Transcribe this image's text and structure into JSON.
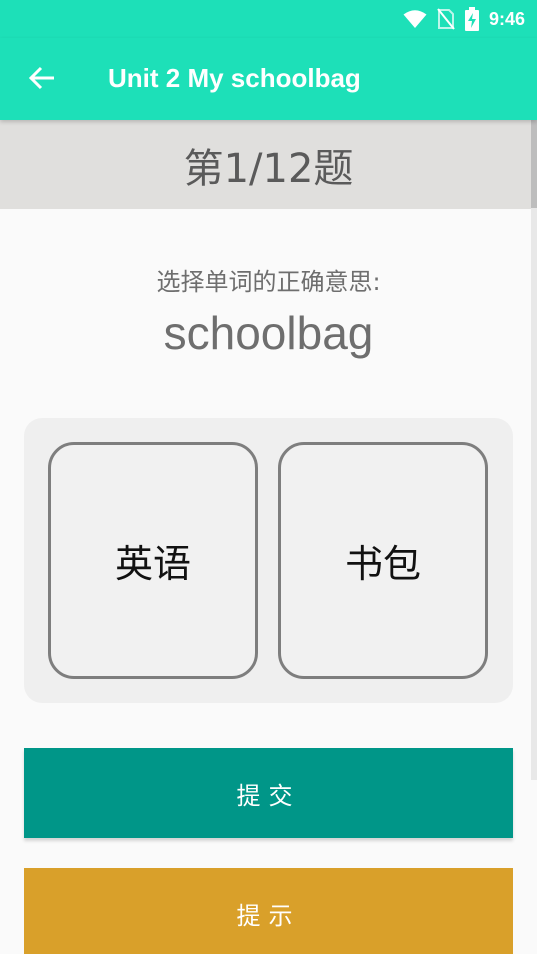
{
  "status_bar": {
    "time": "9:46",
    "icons": [
      "wifi-icon",
      "no-sim-icon",
      "battery-charging-icon"
    ]
  },
  "app_bar": {
    "back_icon": "arrow-left-icon",
    "title": "Unit 2 My schoolbag"
  },
  "question": {
    "counter": "第1/12题",
    "prompt": "选择单词的正确意思:",
    "word": "schoolbag"
  },
  "options": [
    {
      "label": "英语"
    },
    {
      "label": "书包"
    }
  ],
  "buttons": {
    "submit": "提交",
    "hint": "提示"
  },
  "colors": {
    "primary": "#1de0b8",
    "submit": "#009688",
    "hint": "#d9a02a",
    "band": "#e0dfdd"
  }
}
